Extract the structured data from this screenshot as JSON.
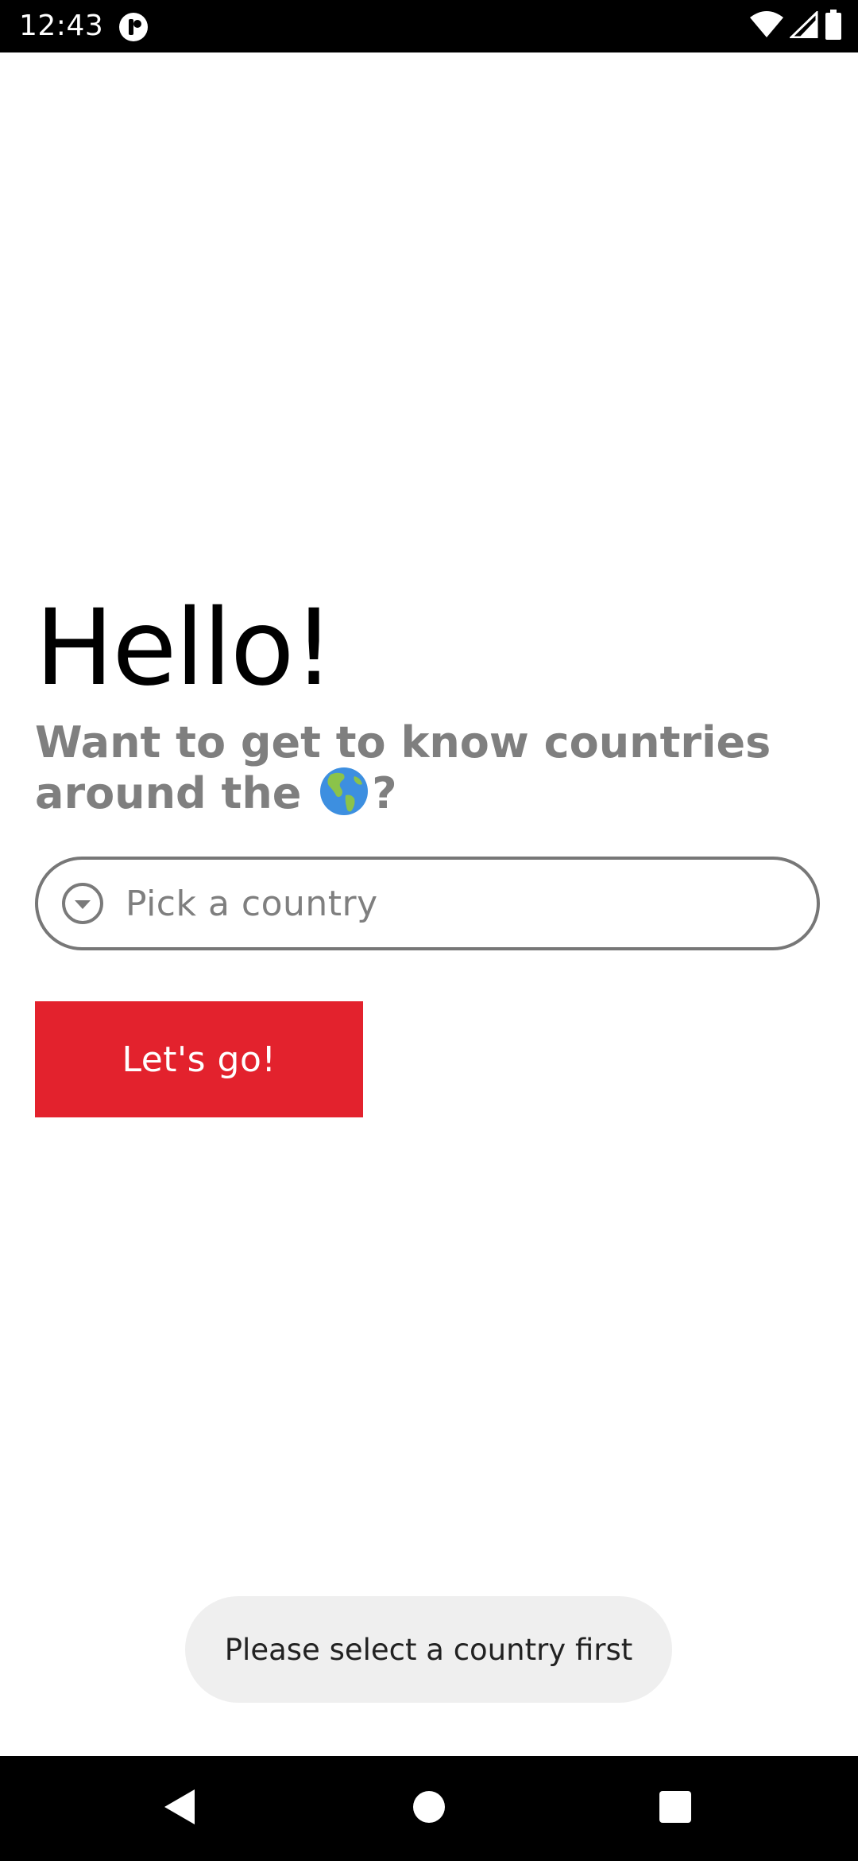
{
  "status_bar": {
    "time": "12:43"
  },
  "main": {
    "title": "Hello!",
    "subtitle_before": "Want to get to know countries around the",
    "subtitle_emoji": "globe-americas-icon",
    "subtitle_after": "?",
    "country_picker": {
      "placeholder": "Pick a country"
    },
    "go_button_label": "Let's go!"
  },
  "toast": {
    "message": "Please select a country first"
  },
  "colors": {
    "accent": "#e3222d",
    "secondary_text": "#7f7f7f",
    "toast_background": "#efefef"
  },
  "icons": {
    "app_status": "app-notification-icon",
    "wifi": "wifi-icon",
    "signal": "cell-signal-icon",
    "battery": "battery-icon",
    "picker": "chevron-down-circle-icon",
    "back": "back-triangle-icon",
    "home": "home-circle-icon",
    "recents": "recents-square-icon"
  }
}
